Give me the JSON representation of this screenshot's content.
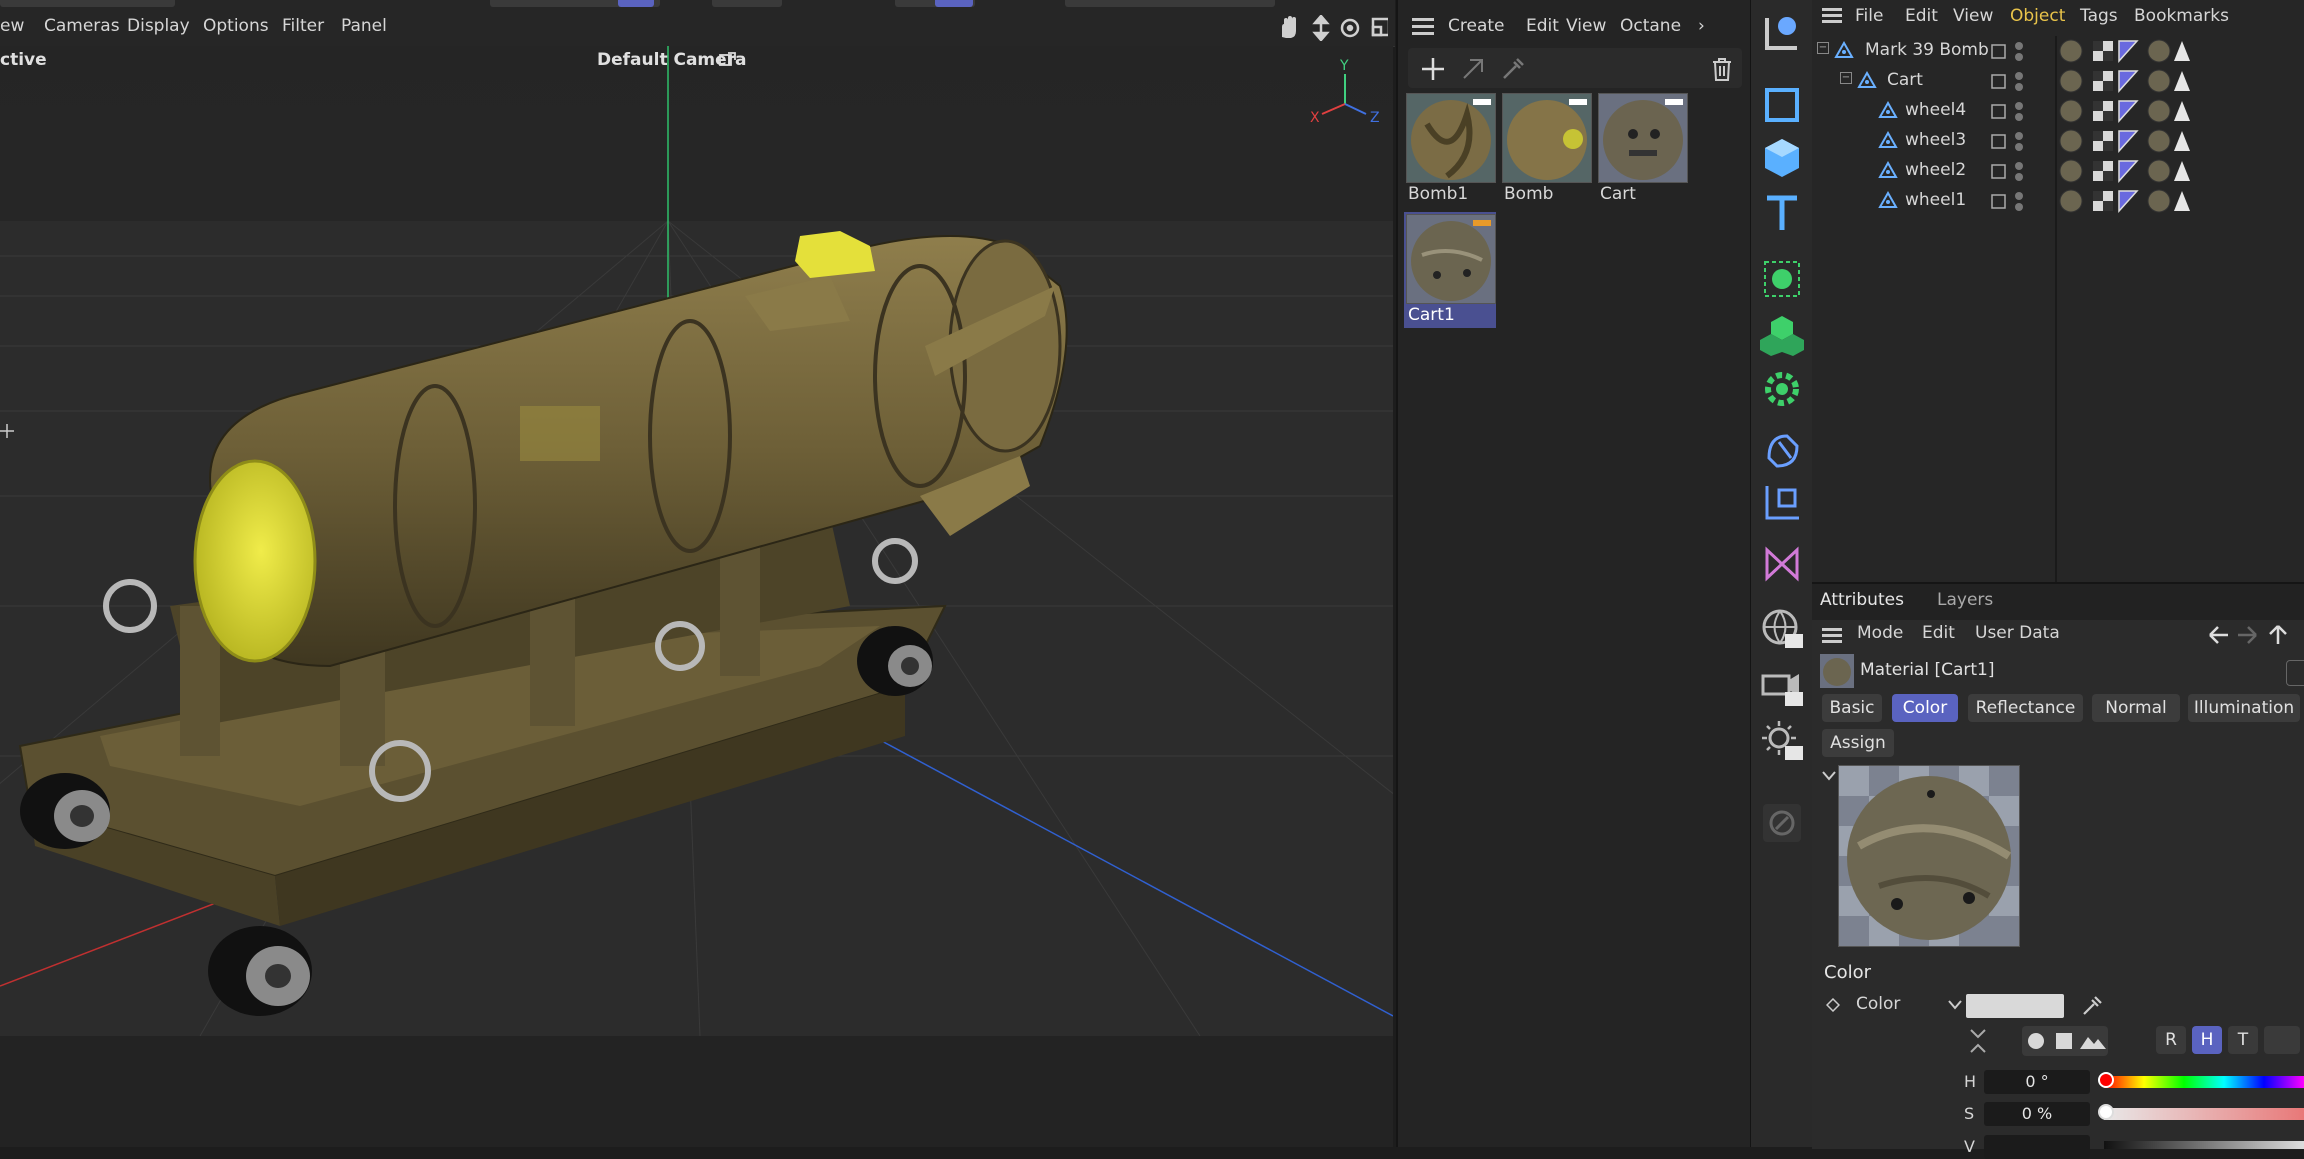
{
  "viewport": {
    "menu": [
      "ew",
      "Cameras",
      "Display",
      "Options",
      "Filter",
      "Panel"
    ],
    "mode_label": "ctive",
    "camera_label": "Default Camera",
    "axis": {
      "x": "X",
      "y": "Y",
      "z": "Z"
    }
  },
  "material_manager": {
    "menu": [
      "Create",
      "Edit",
      "View",
      "Octane"
    ],
    "more": "›",
    "materials": [
      {
        "name": "Bomb1",
        "selected": false
      },
      {
        "name": "Bomb",
        "selected": false
      },
      {
        "name": "Cart",
        "selected": false
      },
      {
        "name": "Cart1",
        "selected": true
      }
    ]
  },
  "object_manager": {
    "menu": [
      "File",
      "Edit",
      "View",
      "Object",
      "Tags",
      "Bookmarks"
    ],
    "active_menu": "Object",
    "objects": [
      {
        "name": "Mark 39 Bomb",
        "depth": 0,
        "expandable": true
      },
      {
        "name": "Cart",
        "depth": 1,
        "expandable": true
      },
      {
        "name": "wheel4",
        "depth": 2,
        "expandable": false
      },
      {
        "name": "wheel3",
        "depth": 2,
        "expandable": false
      },
      {
        "name": "wheel2",
        "depth": 2,
        "expandable": false
      },
      {
        "name": "wheel1",
        "depth": 2,
        "expandable": false
      }
    ]
  },
  "attributes": {
    "tabs": [
      "Attributes",
      "Layers"
    ],
    "menu": [
      "Mode",
      "Edit",
      "User Data"
    ],
    "material_title": "Material [Cart1]",
    "channel_tabs": [
      "Basic",
      "Color",
      "Reflectance",
      "Normal",
      "Illumination"
    ],
    "active_channel": "Color",
    "assign_label": "Assign",
    "section_title": "Color",
    "color_param_label": "Color",
    "color_swatch": "#d9d9d9",
    "mode_buttons": [
      "R",
      "H",
      "T"
    ],
    "active_mode": "H",
    "h_label": "H",
    "h_value": "0 °",
    "s_label": "S",
    "s_value": "0 %",
    "v_label": "V"
  },
  "colors": {
    "accent": "#5a63c0",
    "active_menu": "#e8c34a",
    "axis_x": "#e04040",
    "axis_y": "#40d080",
    "axis_z": "#4070e0"
  }
}
